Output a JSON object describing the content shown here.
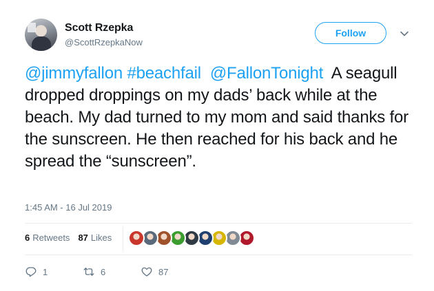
{
  "user": {
    "name": "Scott Rzepka",
    "handle": "@ScottRzepkaNow"
  },
  "follow_label": "Follow",
  "tweet": {
    "mention1": "@jimmyfallon",
    "hashtag": "#beachfail",
    "mention2": "@FallonTonight",
    "line1_rest": "A",
    "body": "seagull dropped droppings on my dads’ back while at the beach.  My dad turned to my mom and said thanks for the sunscreen.  He then reached for his back and he spread the “sunscreen”."
  },
  "timestamp": "1:45 AM - 16 Jul 2019",
  "stats": {
    "retweets_count": "6",
    "retweets_label": "Retweets",
    "likes_count": "87",
    "likes_label": "Likes"
  },
  "likers": [
    {
      "color": "#c9372c"
    },
    {
      "color": "#5b6a7a"
    },
    {
      "color": "#a0522d"
    },
    {
      "color": "#3b9c2f"
    },
    {
      "color": "#2f3a44"
    },
    {
      "color": "#1f3f6e"
    },
    {
      "color": "#d6b600"
    },
    {
      "color": "#7f8a94"
    },
    {
      "color": "#b0182c"
    }
  ],
  "actions": {
    "reply_count": "1",
    "retweet_count": "6",
    "like_count": "87"
  }
}
